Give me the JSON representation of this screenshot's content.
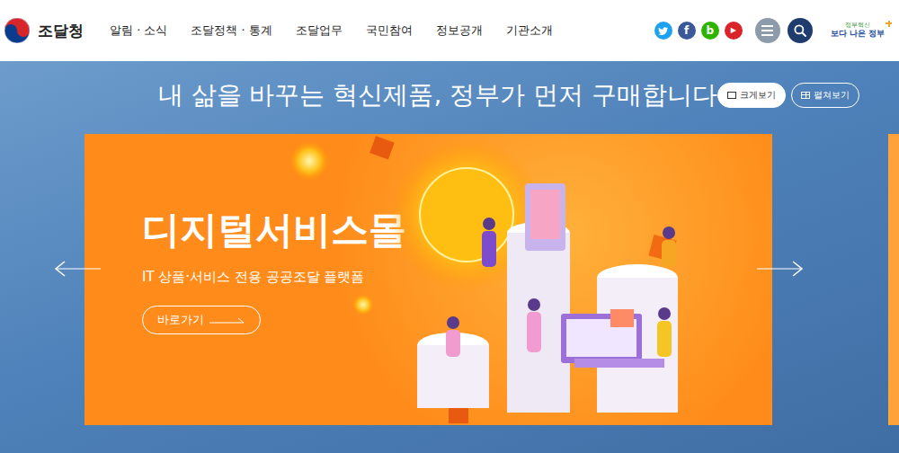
{
  "header": {
    "logo": "조달청",
    "nav": [
      "알림 · 소식",
      "조달정책 · 통계",
      "조달업무",
      "국민참여",
      "정보공개",
      "기관소개"
    ],
    "social": [
      {
        "kind": "twitter",
        "glyph": "",
        "color": "#1da1f2"
      },
      {
        "kind": "facebook",
        "glyph": "f",
        "color": "#3b5998"
      },
      {
        "kind": "blog",
        "glyph": "b",
        "color": "#2db400"
      },
      {
        "kind": "youtube",
        "glyph": "▶",
        "color": "#d9252a"
      }
    ],
    "gov_badge": {
      "top": "정부혁신",
      "bottom": "보다 나은 정부"
    }
  },
  "hero": {
    "headline": "내 삶을 바꾸는 혁신제품, 정부가 먼저 구매합니다",
    "view_buttons": [
      {
        "label": "크게보기",
        "selected": true
      },
      {
        "label": "펼쳐보기",
        "selected": false
      }
    ]
  },
  "slide": {
    "title": "디지털서비스몰",
    "subtitle": "IT 상품·서비스 전용 공공조달 플랫폼",
    "button": "바로가기"
  }
}
